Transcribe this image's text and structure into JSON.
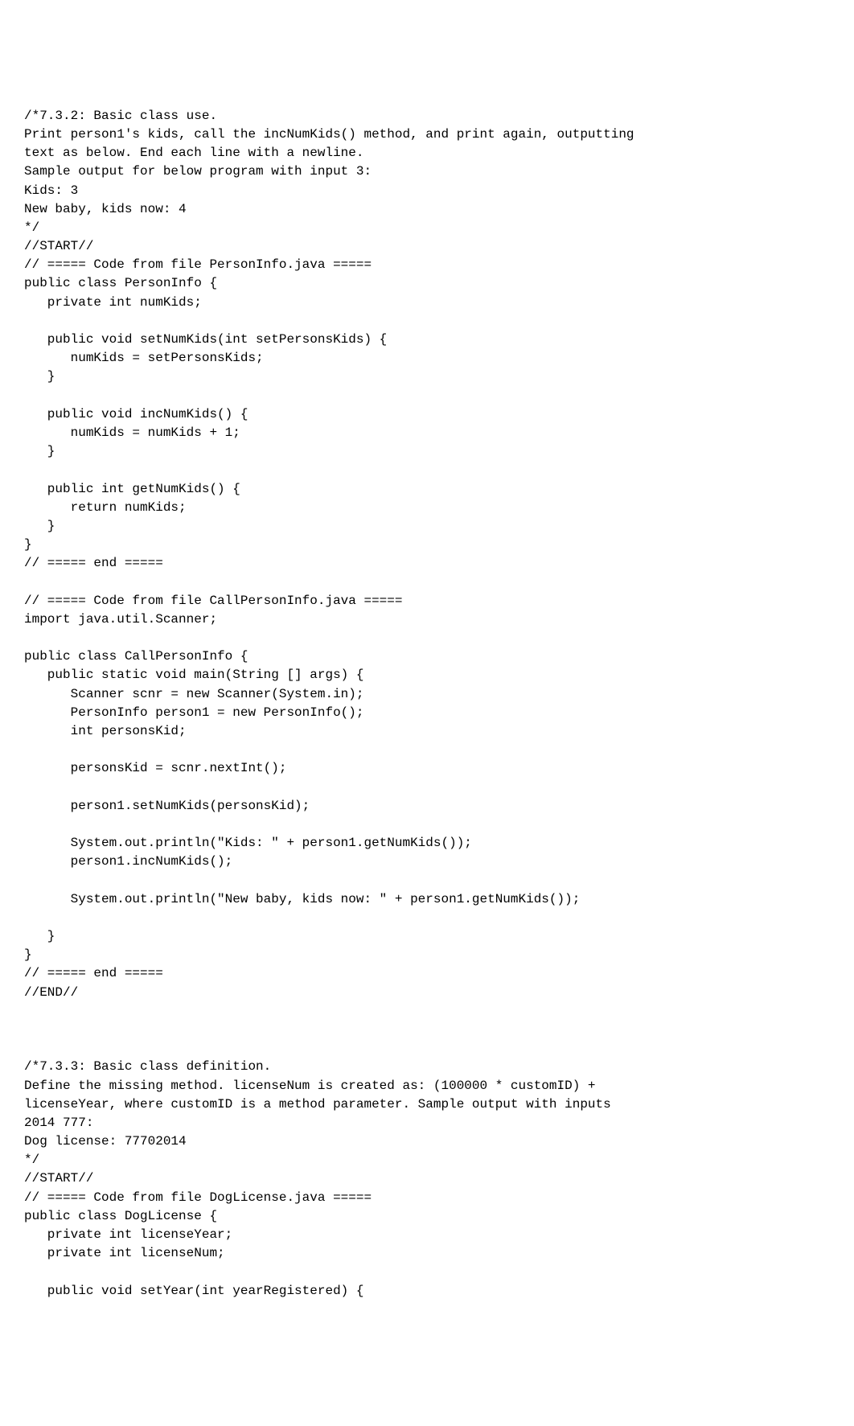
{
  "blocks": [
    {
      "id": "block1",
      "text": "/*7.3.2: Basic class use.\nPrint person1's kids, call the incNumKids() method, and print again, outputting\ntext as below. End each line with a newline.\nSample output for below program with input 3:\nKids: 3\nNew baby, kids now: 4\n*/\n//START//\n// ===== Code from file PersonInfo.java =====\npublic class PersonInfo {\n   private int numKids;\n\n   public void setNumKids(int setPersonsKids) {\n      numKids = setPersonsKids;\n   }\n\n   public void incNumKids() {\n      numKids = numKids + 1;\n   }\n\n   public int getNumKids() {\n      return numKids;\n   }\n}\n// ===== end =====\n\n// ===== Code from file CallPersonInfo.java =====\nimport java.util.Scanner;\n\npublic class CallPersonInfo {\n   public static void main(String [] args) {\n      Scanner scnr = new Scanner(System.in);\n      PersonInfo person1 = new PersonInfo();\n      int personsKid;\n\n      personsKid = scnr.nextInt();\n\n      person1.setNumKids(personsKid);\n\n      System.out.println(\"Kids: \" + person1.getNumKids());\n      person1.incNumKids();\n\n      System.out.println(\"New baby, kids now: \" + person1.getNumKids());\n\n   }\n}\n// ===== end =====\n//END//\n\n\n\n/*7.3.3: Basic class definition.\nDefine the missing method. licenseNum is created as: (100000 * customID) +\nlicenseYear, where customID is a method parameter. Sample output with inputs\n2014 777:\nDog license: 77702014\n*/\n//START//\n// ===== Code from file DogLicense.java =====\npublic class DogLicense {\n   private int licenseYear;\n   private int licenseNum;\n\n   public void setYear(int yearRegistered) {"
    }
  ]
}
